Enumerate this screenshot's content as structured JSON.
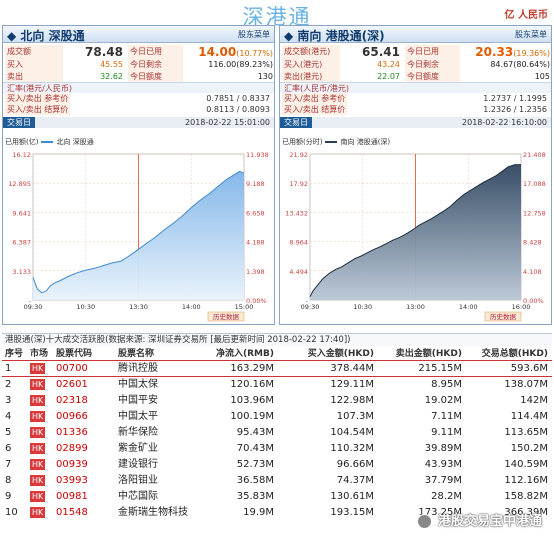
{
  "title": "深港通",
  "unit": "亿 人民币",
  "north": {
    "head": "北向 深股通",
    "more": "股东菜单",
    "rows": [
      {
        "l1": "成交额",
        "v1": "78.48",
        "l2": "今日已用",
        "v2": "14.00",
        "v2b": "(10.77%)"
      },
      {
        "l1": "买入",
        "v1": "45.55",
        "l2": "今日剩余",
        "v2": "116.00",
        "v2b": "(89.23%)"
      },
      {
        "l1": "卖出",
        "v1": "32.62",
        "l2": "今日额度",
        "v2": "130",
        "v2b": ""
      }
    ],
    "fx_head": "汇率(港元/人民币)",
    "fx": [
      {
        "label": "买入/卖出 参考价",
        "value": "0.7851 / 0.8337"
      },
      {
        "label": "买入/卖出 结算价",
        "value": "0.8113 / 0.8093"
      }
    ],
    "trade_tag": "交易日",
    "trade_time": "2018-02-22 15:01:00",
    "chart_cap": "已用额(亿)",
    "legend": "北向 深股通",
    "history": "历史数据"
  },
  "south": {
    "head": "南向 港股通(深)",
    "more": "股东菜单",
    "rows": [
      {
        "l1": "成交额(港元)",
        "v1": "65.41",
        "l2": "今日已用",
        "v2": "20.33",
        "v2b": "(19.36%)"
      },
      {
        "l1": "买入(港元)",
        "v1": "43.24",
        "l2": "今日剩余",
        "v2": "84.67",
        "v2b": "(80.64%)"
      },
      {
        "l1": "卖出(港元)",
        "v1": "22.07",
        "l2": "今日额度",
        "v2": "105",
        "v2b": ""
      }
    ],
    "fx_head": "汇率(人民币/港元)",
    "fx": [
      {
        "label": "买入/卖出 参考价",
        "value": "1.2737 / 1.1995"
      },
      {
        "label": "买入/卖出 结算价",
        "value": "1.2326 / 1.2356"
      }
    ],
    "trade_tag": "交易日",
    "trade_time": "2018-02-22 16:10:00",
    "chart_cap": "已用额(分时)",
    "legend": "南向 港股通(深)",
    "history": "历史数据"
  },
  "chart_data": [
    {
      "type": "area",
      "title": "北向 深股通",
      "ylabel": "已用额(亿)",
      "x_ticks": [
        "09:30",
        "10:30",
        "13:30",
        "14:00",
        "15:00"
      ],
      "y_left_ticks": [
        "16.12",
        "12.895",
        "9.641",
        "6.387",
        "3.133",
        "-"
      ],
      "y_right_ticks": [
        "11.938",
        "9.188",
        "6.658",
        "4.188",
        "1.398",
        "0.00%"
      ],
      "x": [
        0,
        5,
        10,
        15,
        20,
        25,
        30,
        40,
        50,
        60,
        70,
        80,
        90,
        100,
        110,
        120,
        130,
        140,
        150,
        160,
        170,
        180,
        190,
        200,
        210,
        220,
        230,
        235,
        240
      ],
      "y": [
        2.5,
        1.2,
        0.8,
        1.0,
        1.6,
        1.9,
        2.1,
        2.6,
        3.0,
        3.3,
        3.5,
        3.8,
        4.1,
        4.3,
        4.9,
        5.6,
        6.3,
        7.0,
        7.8,
        8.5,
        9.3,
        10.2,
        11.0,
        11.7,
        12.5,
        13.3,
        13.9,
        14.2,
        14.0
      ],
      "ylim": [
        0,
        16.12
      ],
      "xlim": [
        0,
        240
      ]
    },
    {
      "type": "area",
      "title": "南向 港股通(深)",
      "ylabel": "已用额(分时)",
      "x_ticks": [
        "09:30",
        "10:30",
        "13:00",
        "14:00",
        "16:00"
      ],
      "y_left_ticks": [
        "21.92",
        "17.92",
        "13.432",
        "8.964",
        "4.494",
        "-"
      ],
      "y_right_ticks": [
        "21.408",
        "17.088",
        "12.758",
        "8.428",
        "4.108",
        "0.00%"
      ],
      "x": [
        0,
        5,
        10,
        20,
        30,
        40,
        50,
        60,
        70,
        80,
        90,
        100,
        110,
        120,
        130,
        140,
        150,
        160,
        170,
        180,
        190,
        200,
        210,
        220,
        230,
        240,
        250,
        260,
        270,
        280,
        290,
        300,
        310,
        320,
        330
      ],
      "y": [
        0.5,
        1.4,
        2.0,
        3.2,
        4.0,
        4.6,
        5.0,
        5.6,
        6.2,
        6.6,
        7.1,
        7.6,
        8.0,
        8.5,
        9.0,
        9.4,
        9.9,
        10.5,
        11.2,
        11.7,
        12.2,
        12.8,
        13.4,
        14.1,
        15.0,
        15.8,
        16.4,
        17.0,
        17.6,
        18.1,
        18.6,
        19.3,
        20.0,
        20.3,
        20.33
      ],
      "ylim": [
        0,
        21.92
      ],
      "xlim": [
        0,
        330
      ]
    }
  ],
  "table": {
    "title": "港股通(深)十大成交活跃股(数据来源: 深圳证券交易所 [最后更新时间 2018-02-22 17:40])",
    "headers": [
      "序号",
      "市场",
      "股票代码",
      "股票名称",
      "净流入(RMB)",
      "买入金额(HKD)",
      "卖出金额(HKD)",
      "交易总额(HKD)"
    ],
    "rows": [
      [
        "1",
        "HK",
        "00700",
        "腾讯控股",
        "163.29M",
        "378.44M",
        "215.15M",
        "593.6M"
      ],
      [
        "2",
        "HK",
        "02601",
        "中国太保",
        "120.16M",
        "129.11M",
        "8.95M",
        "138.07M"
      ],
      [
        "3",
        "HK",
        "02318",
        "中国平安",
        "103.96M",
        "122.98M",
        "19.02M",
        "142M"
      ],
      [
        "4",
        "HK",
        "00966",
        "中国太平",
        "100.19M",
        "107.3M",
        "7.11M",
        "114.4M"
      ],
      [
        "5",
        "HK",
        "01336",
        "新华保险",
        "95.43M",
        "104.54M",
        "9.11M",
        "113.65M"
      ],
      [
        "6",
        "HK",
        "02899",
        "紫金矿业",
        "70.43M",
        "110.32M",
        "39.89M",
        "150.2M"
      ],
      [
        "7",
        "HK",
        "00939",
        "建设银行",
        "52.73M",
        "96.66M",
        "43.93M",
        "140.59M"
      ],
      [
        "8",
        "HK",
        "03993",
        "洛阳钼业",
        "36.58M",
        "74.37M",
        "37.79M",
        "112.16M"
      ],
      [
        "9",
        "HK",
        "00981",
        "中芯国际",
        "35.83M",
        "130.61M",
        "28.2M",
        "158.82M"
      ],
      [
        "10",
        "HK",
        "01548",
        "金斯瑞生物科技",
        "19.9M",
        "193.15M",
        "173.25M",
        "366.39M"
      ]
    ]
  },
  "watermark": "港股交易宝中港通"
}
